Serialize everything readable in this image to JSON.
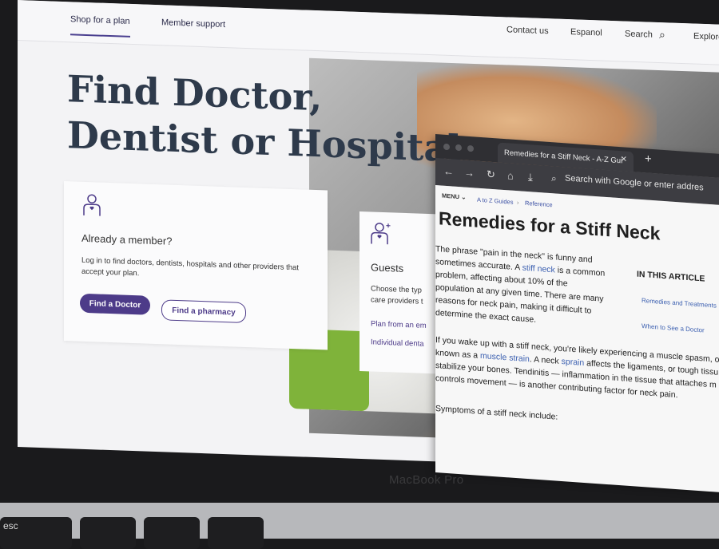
{
  "site": {
    "nav_tabs": [
      "Shop for a plan",
      "Member support"
    ],
    "util_links": [
      "Contact us",
      "Espanol",
      "Search",
      "Explore"
    ],
    "hero_title": "Find Doctor, Dentist or Hospital",
    "member_card": {
      "title": "Already a member?",
      "text": "Log in to find doctors, dentists, hospitals and other providers that accept your plan.",
      "btn_doctor": "Find a Doctor",
      "btn_pharmacy": "Find a pharmacy"
    },
    "guest_card": {
      "title": "Guests",
      "text_1": "Choose the typ",
      "text_2": "care providers t",
      "link_1": "Plan from an em",
      "link_2": "Individual denta"
    }
  },
  "browser": {
    "tab_title": "Remedies for a Stiff Neck - A-Z Gui",
    "tab_close": "✕",
    "new_tab": "+",
    "url_placeholder": "Search with Google or enter addres",
    "menu": "MENU",
    "breadcrumb": [
      "A to Z Guides",
      "Reference"
    ],
    "article": {
      "title": "Remedies for a Stiff Neck",
      "p1_a": "The phrase \"pain in the neck\" is funny and",
      "p1_b": "sometimes accurate. A ",
      "p1_link": "stiff neck",
      "p1_c": " is a common",
      "p1_d": "problem, affecting about 10% of the",
      "p1_e": "population at any given time. There are many",
      "p1_f": "reasons for neck pain, making it difficult to",
      "p1_g": "determine the exact cause.",
      "p2_a": "If you wake up with a stiff neck, you're likely experiencing a muscle spasm, o",
      "p2_b1": "known as a ",
      "p2_link1": "muscle strain",
      "p2_b2": ". A neck ",
      "p2_link2": "sprain",
      "p2_b3": " affects the ligaments, or tough tissu",
      "p2_c": "stabilize your bones. Tendinitis — inflammation in the tissue that attaches m",
      "p2_d": "controls movement — is another contributing factor for neck pain.",
      "p3": "Symptoms of a stiff neck include:"
    },
    "toc": {
      "heading": "IN THIS ARTICLE",
      "items": [
        "Remedies and Treatments",
        "When to See a Doctor"
      ]
    }
  },
  "hardware": {
    "bezel_label": "MacBook Pro",
    "esc_key": "esc"
  },
  "colors": {
    "brand_purple": "#4d3b89",
    "link_blue": "#3b5fb0",
    "title_navy": "#2e3a4b"
  }
}
